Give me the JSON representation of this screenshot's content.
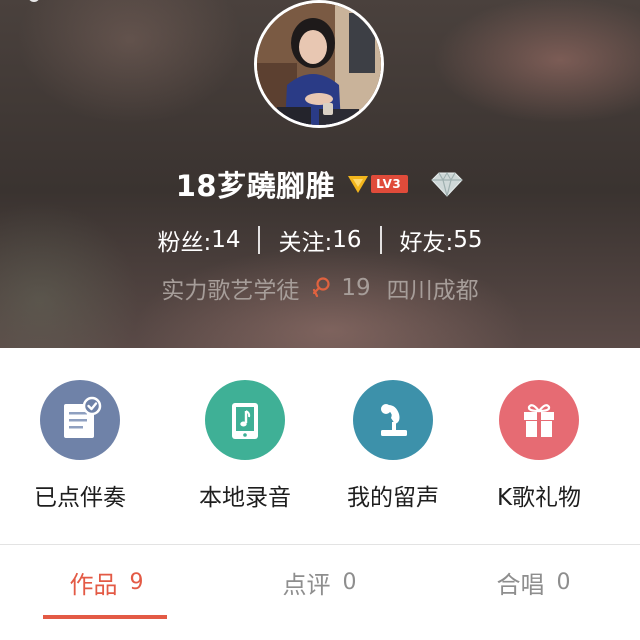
{
  "profile": {
    "name": "18芗蹺腳脽",
    "level_badge": "LV3",
    "stats": {
      "fans_label": "粉丝:",
      "fans_value": "14",
      "following_label": "关注:",
      "following_value": "16",
      "friends_label": "好友:",
      "friends_value": "55"
    },
    "title": "实力歌艺学徒",
    "age": "19",
    "location": "四川成都"
  },
  "actions": [
    {
      "label": "已点伴奏",
      "icon": "accompaniment-list-icon",
      "color": "#6f82a8"
    },
    {
      "label": "本地录音",
      "icon": "local-recording-icon",
      "color": "#3fb096"
    },
    {
      "label": "我的留声",
      "icon": "gramophone-icon",
      "color": "#3d91aa"
    },
    {
      "label": "K歌礼物",
      "icon": "gift-icon",
      "color": "#e66b73"
    }
  ],
  "tabs": [
    {
      "label": "作品",
      "count": "9",
      "active": true
    },
    {
      "label": "点评",
      "count": "0",
      "active": false
    },
    {
      "label": "合唱",
      "count": "0",
      "active": false
    }
  ],
  "colors": {
    "accent": "#e35a45",
    "level_badge": "#e04b3a",
    "vip_gold": "#f2b51c",
    "gender_female": "#e0623f"
  }
}
